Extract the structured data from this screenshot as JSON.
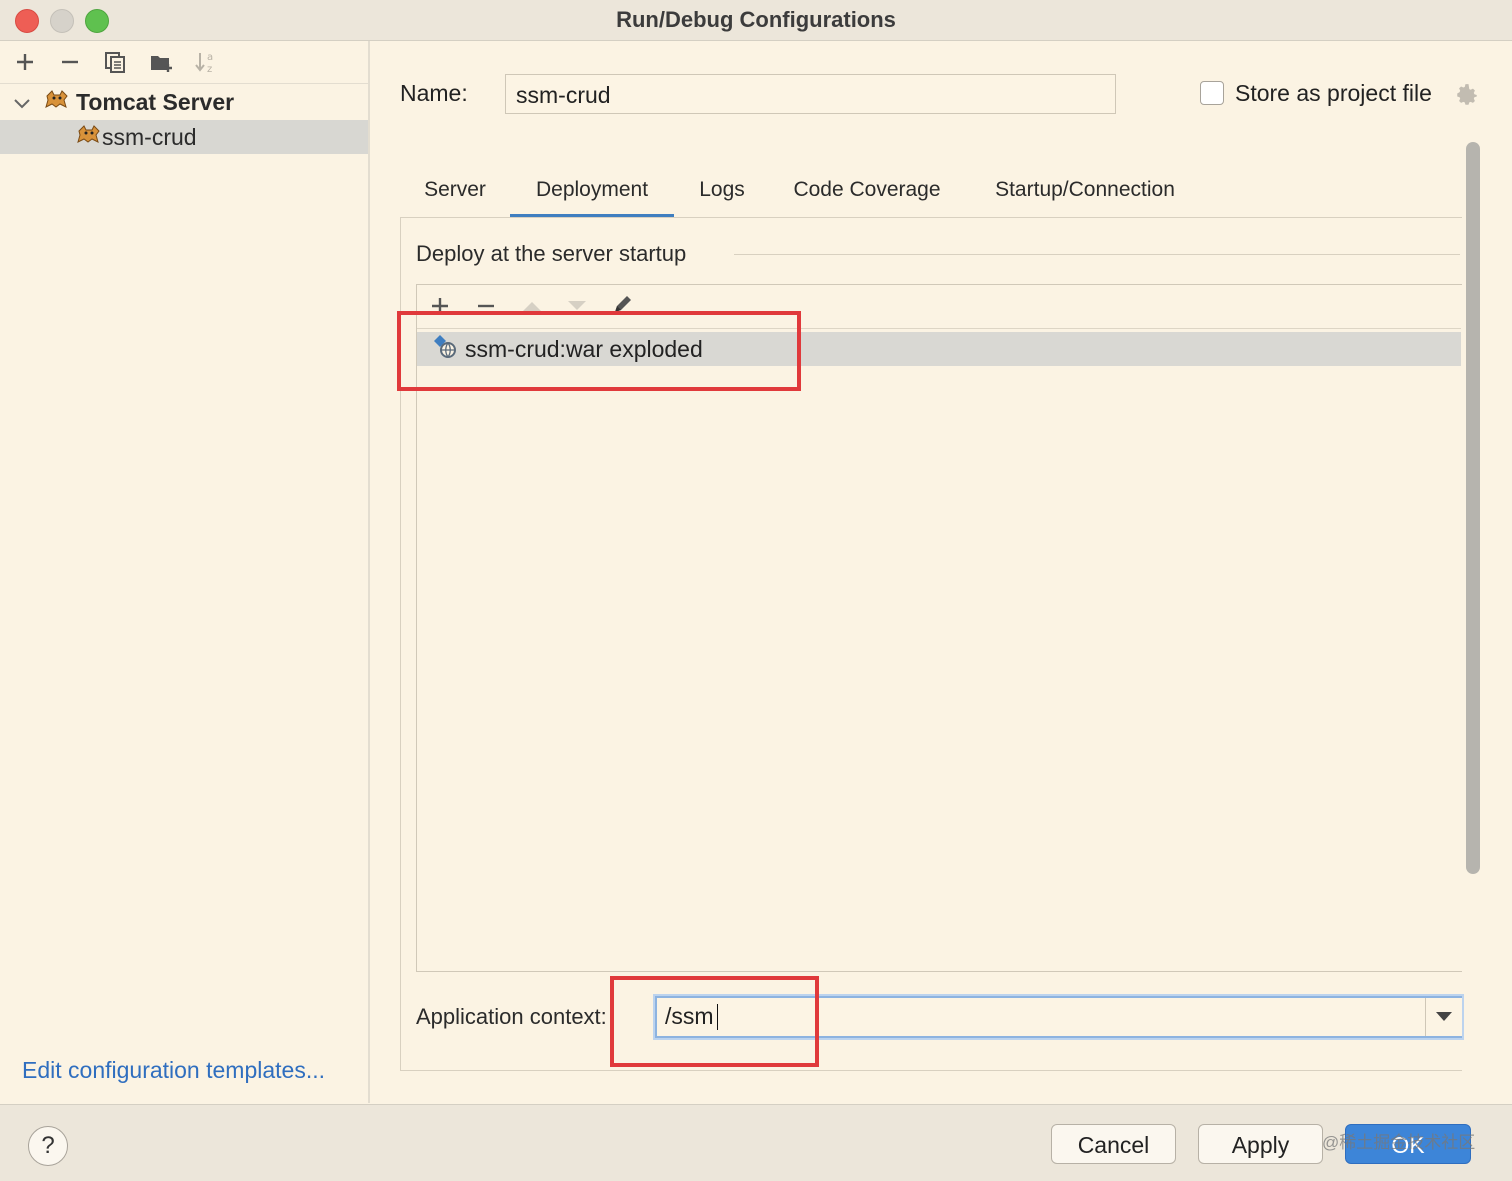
{
  "window": {
    "title": "Run/Debug Configurations",
    "buttons": [
      "close",
      "minimize",
      "zoom"
    ]
  },
  "sidebar": {
    "toolbar_icons": [
      "add-icon",
      "remove-icon",
      "copy-icon",
      "folder-add-icon",
      "sort-icon"
    ],
    "tree": {
      "group_label": "Tomcat Server",
      "child_label": "ssm-crud"
    },
    "edit_templates": "Edit configuration templates..."
  },
  "form": {
    "name_label": "Name:",
    "name_value": "ssm-crud",
    "store_label": "Store as project file",
    "store_checked": false
  },
  "tabs": [
    {
      "label": "Server"
    },
    {
      "label": "Deployment"
    },
    {
      "label": "Logs"
    },
    {
      "label": "Code Coverage"
    },
    {
      "label": "Startup/Connection"
    }
  ],
  "active_tab": "Deployment",
  "deployment": {
    "section_title": "Deploy at the server startup",
    "toolbar_icons": [
      "add-icon",
      "remove-icon",
      "move-up-icon",
      "move-down-icon",
      "edit-icon"
    ],
    "artifacts": [
      "ssm-crud:war exploded"
    ],
    "context_label": "Application context:",
    "context_value": "/ssm"
  },
  "footer": {
    "help": "?",
    "cancel": "Cancel",
    "apply": "Apply",
    "ok": "OK",
    "watermark": "@稀土掘金技术社区"
  },
  "colors": {
    "background": "#fbf3e3",
    "accent": "#3f7ec0",
    "annotation": "#e0393b",
    "link": "#2f6ebf"
  }
}
